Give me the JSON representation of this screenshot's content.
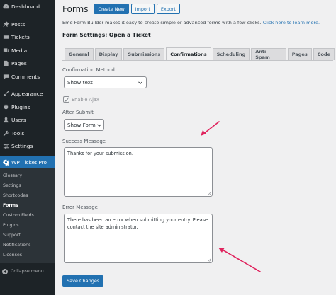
{
  "sidebar": {
    "top_items": [
      {
        "label": "Dashboard",
        "icon": "dashboard-icon"
      },
      {
        "label": "Posts",
        "icon": "pin-icon"
      },
      {
        "label": "Tickets",
        "icon": "ticket-icon"
      },
      {
        "label": "Media",
        "icon": "media-icon"
      },
      {
        "label": "Pages",
        "icon": "pages-icon"
      },
      {
        "label": "Comments",
        "icon": "comment-icon"
      }
    ],
    "mid_items": [
      {
        "label": "Appearance",
        "icon": "brush-icon"
      },
      {
        "label": "Plugins",
        "icon": "plugin-icon"
      },
      {
        "label": "Users",
        "icon": "user-icon"
      },
      {
        "label": "Tools",
        "icon": "wrench-icon"
      },
      {
        "label": "Settings",
        "icon": "settings-icon"
      }
    ],
    "active_item": {
      "label": "WP Ticket Pro",
      "icon": "gear-icon"
    },
    "submenu": [
      "Glossary",
      "Settings",
      "Shortcodes",
      "Forms",
      "Custom Fields",
      "Plugins",
      "Support",
      "Notifications",
      "Licenses"
    ],
    "current_submenu": "Forms",
    "collapse_label": "Collapse menu"
  },
  "header": {
    "title": "Forms",
    "create_new": "Create New",
    "import": "Import",
    "export": "Export"
  },
  "description": {
    "text": "Emd Form Builder makes it easy to create simple or advanced forms with a few clicks.",
    "link": "Click here to learn more."
  },
  "form_heading": "Form Settings: Open a Ticket",
  "tabs": [
    "General",
    "Display",
    "Submissions",
    "Confirmations",
    "Scheduling",
    "Anti Spam",
    "Pages",
    "Code"
  ],
  "active_tab": "Confirmations",
  "confirmation_method": {
    "label": "Confirmation Method",
    "value": "Show text"
  },
  "enable_ajax": {
    "label": "Enable Ajax",
    "checked": true
  },
  "after_submit": {
    "label": "After Submit",
    "value": "Show Form"
  },
  "success_message": {
    "label": "Success Message",
    "value": "Thanks for your submission."
  },
  "error_message": {
    "label": "Error Message",
    "value": "There has been an error when submitting your entry. Please contact the site administrator."
  },
  "save_label": "Save Changes",
  "colors": {
    "sidebar_bg": "#1d2327",
    "accent": "#2271b1",
    "annotation_arrow": "#e0245e"
  }
}
